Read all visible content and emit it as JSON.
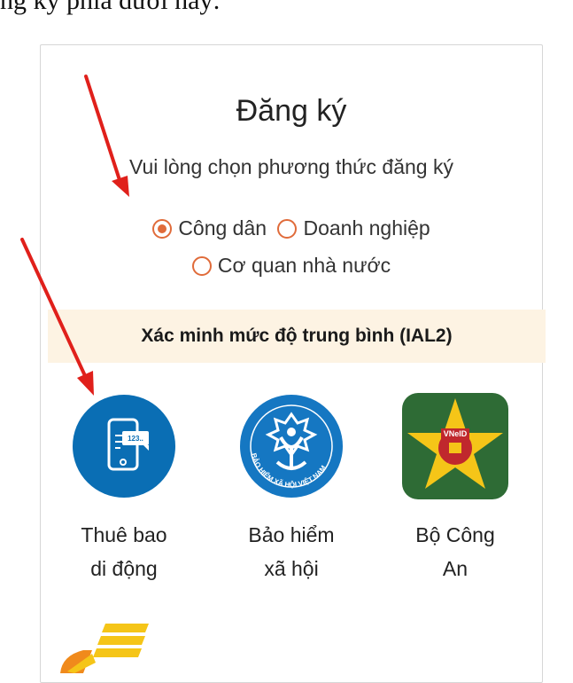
{
  "top_partial_text": "ng ký phía dưới này:",
  "card": {
    "title": "Đăng ký",
    "subtitle": "Vui lòng chọn phương thức đăng ký",
    "radios": [
      {
        "label": "Công dân",
        "checked": true
      },
      {
        "label": "Doanh nghiệp",
        "checked": false
      },
      {
        "label": "Cơ quan nhà nước",
        "checked": false
      }
    ],
    "section_title": "Xác minh mức độ trung bình (IAL2)",
    "services": [
      {
        "line1": "Thuê bao",
        "line2": "di động",
        "icon": "mobile-subscriber-icon"
      },
      {
        "line1": "Bảo hiểm",
        "line2": "xã hội",
        "icon": "social-insurance-logo"
      },
      {
        "line1": "Bộ Công",
        "line2": "An",
        "icon": "vneid-logo"
      }
    ],
    "phone_screen_text": "123..",
    "logo_texts": {
      "bhxh_ring": "BẢO HIỂM XÃ HỘI VIỆT NAM",
      "vneid": "VNeID"
    }
  },
  "colors": {
    "radio_accent": "#e06b3a",
    "band_bg": "#fdf3e3",
    "mobile_blue": "#0a6eb4",
    "vneid_green": "#2e6b35",
    "arrow_red": "#e0201b"
  }
}
